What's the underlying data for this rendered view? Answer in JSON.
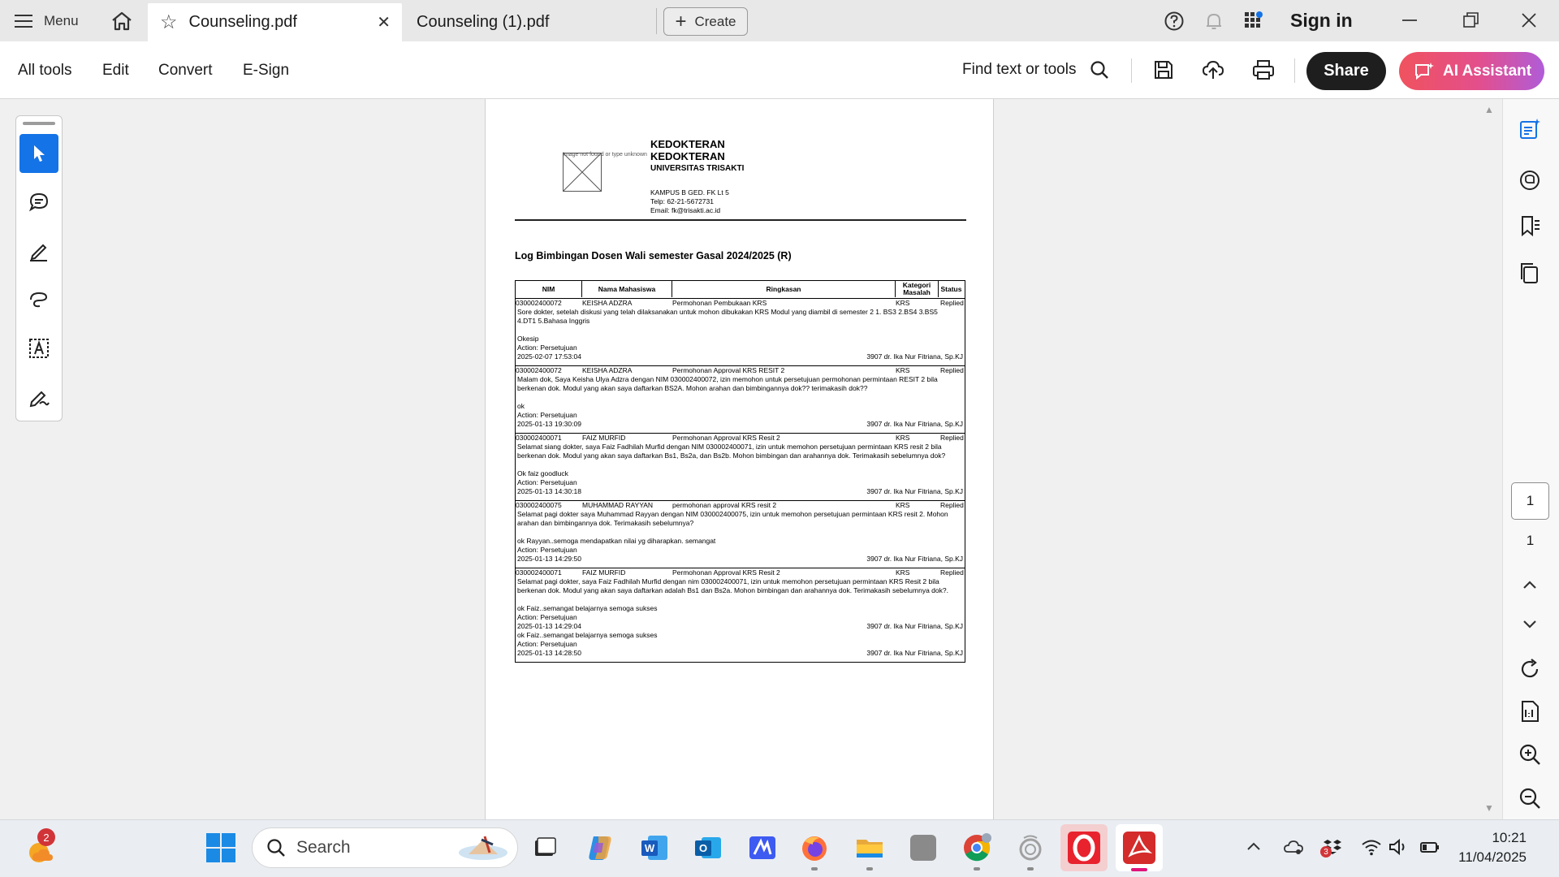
{
  "titlebar": {
    "menu_label": "Menu",
    "tabs": [
      {
        "label": "Counseling.pdf",
        "active": true
      },
      {
        "label": "Counseling (1).pdf",
        "active": false
      }
    ],
    "create_label": "Create",
    "sign_in_label": "Sign in"
  },
  "toolbar": {
    "menu_items": [
      "All tools",
      "Edit",
      "Convert",
      "E-Sign"
    ],
    "find_label": "Find text or tools",
    "share_label": "Share",
    "ai_label": "AI Assistant",
    "colors": {
      "share_bg": "#1e1e1e",
      "ai_gradient_start": "#f0525e",
      "ai_gradient_end": "#b05cd8",
      "select_tool": "#1473e6"
    }
  },
  "left_tools": [
    "select-tool",
    "add-comment-tool",
    "highlight-tool",
    "draw-freeform-tool",
    "text-recognition-tool",
    "fill-sign-tool"
  ],
  "document": {
    "letterhead": {
      "image_caption": "Image not found or type unknown",
      "line1": "KEDOKTERAN",
      "line2": "KEDOKTERAN",
      "line3": "UNIVERSITAS TRISAKTI",
      "address": [
        "KAMPUS B GED. FK Lt 5",
        "Telp: 62-21-5672731",
        "Email: fk@trisakti.ac.id"
      ]
    },
    "title": "Log Bimbingan Dosen Wali semester Gasal 2024/2025 (R)",
    "columns": [
      "NIM",
      "Nama Mahasiswa",
      "Ringkasan",
      "Kategori Masalah",
      "Status"
    ],
    "entries": [
      {
        "nim": "030002400072",
        "name": "KEISHA ADZRA",
        "subject": "Permohonan Pembukaan KRS",
        "category": "KRS",
        "status": "Replied",
        "message": [
          "Sore dokter, setelah diskusi yang telah dilaksanakan untuk mohon dibukakan KRS Modul yang diambil di semester 2 1. BS3 2.BS4 3.BS5",
          "4.DT1 5.Bahasa Inggris"
        ],
        "replies": [
          {
            "text": "Okesip",
            "action": "Action: Persetujuan",
            "datetime": "2025-02-07 17:53:04",
            "lecturer": "3907 dr. Ika Nur Fitriana, Sp.KJ"
          }
        ]
      },
      {
        "nim": "030002400072",
        "name": "KEISHA ADZRA",
        "subject": "Permohonan Approval KRS RESIT 2",
        "category": "KRS",
        "status": "Replied",
        "message": [
          "Malam dok, Saya Keisha Ulya Adzra dengan NIM 030002400072, izin memohon untuk persetujuan permohonan permintaan RESIT 2 bila",
          "berkenan dok. Modul yang akan saya daftarkan BS2A. Mohon arahan dan bimbingannya dok?? terimakasih dok??"
        ],
        "replies": [
          {
            "text": "ok",
            "action": "Action: Persetujuan",
            "datetime": "2025-01-13 19:30:09",
            "lecturer": "3907 dr. Ika Nur Fitriana, Sp.KJ"
          }
        ]
      },
      {
        "nim": "030002400071",
        "name": "FAIZ MURFID",
        "subject": "Permohonan Approval KRS Resit 2",
        "category": "KRS",
        "status": "Replied",
        "message": [
          "Selamat siang dokter, saya Faiz Fadhilah Murfid dengan NIM 030002400071, izin untuk memohon persetujuan permintaan KRS resit 2 bila",
          "berkenan dok. Modul yang akan saya daftarkan Bs1, Bs2a, dan Bs2b. Mohon bimbingan dan arahannya dok. Terimakasih sebelumnya dok?"
        ],
        "replies": [
          {
            "text": "Ok faiz goodluck",
            "action": "Action: Persetujuan",
            "datetime": "2025-01-13 14:30:18",
            "lecturer": "3907 dr. Ika Nur Fitriana, Sp.KJ"
          }
        ]
      },
      {
        "nim": "030002400075",
        "name": "MUHAMMAD RAYYAN",
        "subject": "permohonan approval KRS resit 2",
        "category": "KRS",
        "status": "Replied",
        "message": [
          "Selamat pagi dokter saya Muhammad Rayyan dengan NIM 030002400075, izin untuk memohon persetujuan permintaan KRS resit 2. Mohon",
          "arahan dan bimbingannya dok. Terimakasih sebelumnya?"
        ],
        "replies": [
          {
            "text": "ok Rayyan..semoga mendapatkan nilai yg diharapkan. semangat",
            "action": "Action: Persetujuan",
            "datetime": "2025-01-13 14:29:50",
            "lecturer": "3907 dr. Ika Nur Fitriana, Sp.KJ"
          }
        ]
      },
      {
        "nim": "030002400071",
        "name": "FAIZ MURFID",
        "subject": "Permohonan Approval KRS Resit 2",
        "category": "KRS",
        "status": "Replied",
        "message": [
          "Selamat pagi dokter, saya Faiz Fadhilah Murfid dengan nim 030002400071, izin untuk memohon persetujuan permintaan KRS Resit 2 bila",
          "berkenan dok. Modul yang akan saya daftarkan adalah Bs1 dan Bs2a. Mohon bimbingan dan arahannya dok. Terimakasih sebelumnya dok?."
        ],
        "replies": [
          {
            "text": "ok Faiz..semangat belajarnya semoga sukses",
            "action": "Action: Persetujuan",
            "datetime": "2025-01-13 14:29:04",
            "lecturer": "3907 dr. Ika Nur Fitriana, Sp.KJ"
          },
          {
            "text": "ok Faiz..semangat belajarnya semoga sukses",
            "action": "Action: Persetujuan",
            "datetime": "2025-01-13 14:28:50",
            "lecturer": "3907 dr. Ika Nur Fitriana, Sp.KJ"
          }
        ]
      }
    ]
  },
  "page_nav": {
    "current": "1",
    "total": "1"
  },
  "taskbar": {
    "notification_count": "2",
    "search_placeholder": "Search",
    "app_icons": [
      "windows-start-icon",
      "desktop-icon",
      "copilot-icon",
      "word-icon",
      "outlook-icon",
      "app-icon",
      "firefox-icon",
      "file-explorer-icon",
      "generic-app-icon",
      "chrome-icon",
      "cortana-icon",
      "opera-icon",
      "acrobat-icon"
    ],
    "tray_badge": "3",
    "time": "10:21",
    "date": "11/04/2025"
  }
}
